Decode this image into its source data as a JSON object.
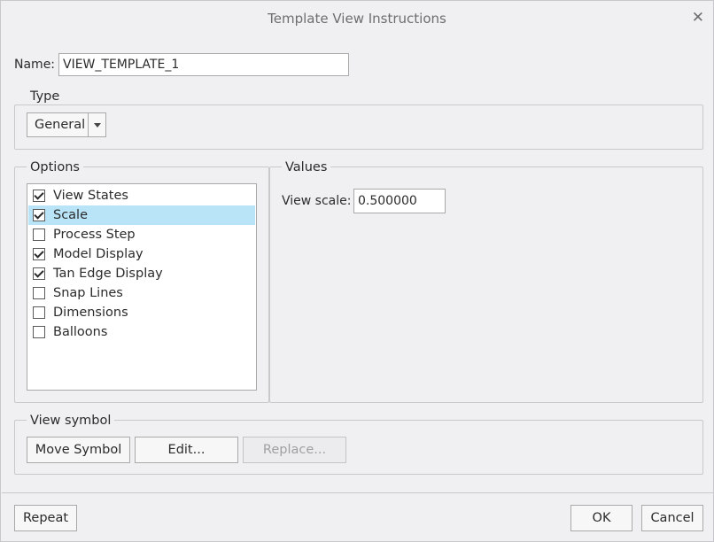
{
  "dialog": {
    "title": "Template View Instructions",
    "close_glyph": "✕"
  },
  "name_field": {
    "label": "Name:",
    "value": "VIEW_TEMPLATE_1"
  },
  "type_group": {
    "legend": "Type",
    "selected": "General"
  },
  "options_group": {
    "legend": "Options",
    "items": [
      {
        "label": "View States",
        "checked": true,
        "selected": false
      },
      {
        "label": "Scale",
        "checked": true,
        "selected": true
      },
      {
        "label": "Process Step",
        "checked": false,
        "selected": false
      },
      {
        "label": "Model Display",
        "checked": true,
        "selected": false
      },
      {
        "label": "Tan Edge Display",
        "checked": true,
        "selected": false
      },
      {
        "label": "Snap Lines",
        "checked": false,
        "selected": false
      },
      {
        "label": "Dimensions",
        "checked": false,
        "selected": false
      },
      {
        "label": "Balloons",
        "checked": false,
        "selected": false
      }
    ]
  },
  "values_group": {
    "legend": "Values",
    "view_scale_label": "View scale:",
    "view_scale_value": "0.500000"
  },
  "view_symbol_group": {
    "legend": "View symbol",
    "move_symbol": "Move Symbol",
    "edit": "Edit...",
    "replace": "Replace..."
  },
  "footer": {
    "repeat": "Repeat",
    "ok": "OK",
    "cancel": "Cancel"
  },
  "colors": {
    "selection": "#b9e4f8",
    "background": "#f0f0f2"
  }
}
